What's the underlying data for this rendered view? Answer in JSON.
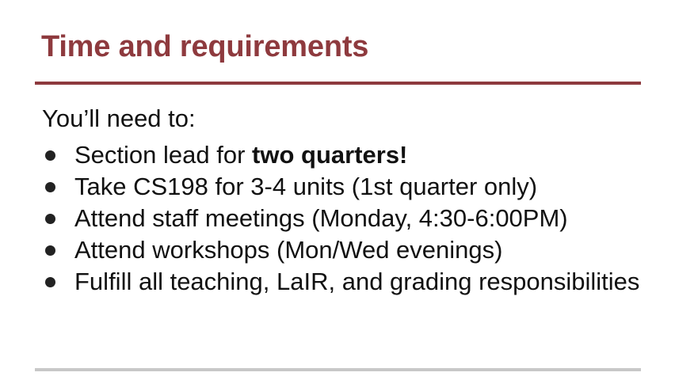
{
  "slide": {
    "title": "Time and requirements",
    "intro": "You’ll need to:",
    "bullets": [
      {
        "prefix": "Section lead for ",
        "emphasis": "two quarters!"
      },
      {
        "text": "Take CS198 for 3-4 units (1st quarter only)"
      },
      {
        "text": "Attend staff meetings (Monday, 4:30-6:00PM)"
      },
      {
        "text": "Attend workshops (Mon/Wed evenings)"
      },
      {
        "text": "Fulfill all teaching, LaIR, and grading responsibilities"
      }
    ]
  },
  "colors": {
    "accent": "#8e3a3e",
    "text": "#111111",
    "footer_rule": "#c8c8c8"
  }
}
